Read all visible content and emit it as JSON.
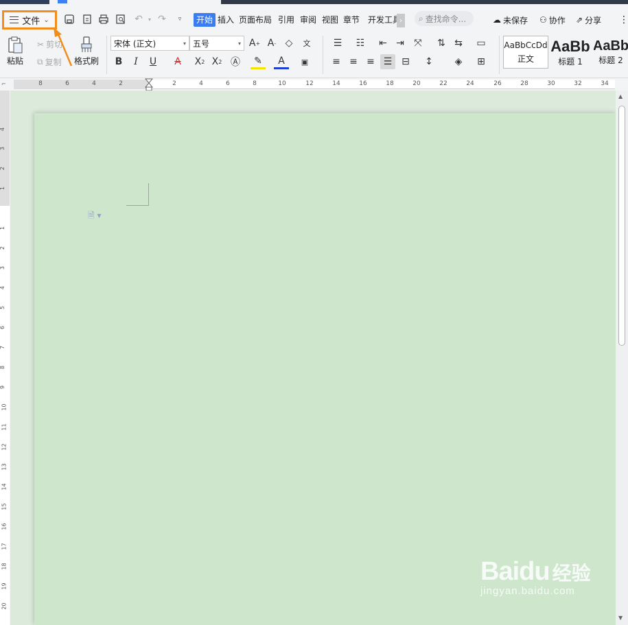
{
  "menubar": {
    "file_label": "文件",
    "tabs": [
      "开始",
      "插入",
      "页面布局",
      "引用",
      "审阅",
      "视图",
      "章节",
      "开发工具"
    ],
    "search_placeholder": "查找命令...",
    "unsaved": "未保存",
    "collaborate": "协作",
    "share": "分享"
  },
  "ribbon": {
    "paste": "粘贴",
    "cut": "剪切",
    "copy": "复制",
    "format_painter": "格式刷",
    "font_name": "宋体 (正文)",
    "font_size": "五号",
    "styles": [
      {
        "preview": "AaBbCcDd",
        "name": "正文"
      },
      {
        "preview": "AaBb",
        "name": "标题 1"
      },
      {
        "preview": "AaBb",
        "name": "标题 2"
      }
    ]
  },
  "hruler": {
    "ticks": [
      {
        "label": "8"
      },
      {
        "label": "6"
      },
      {
        "label": "4"
      },
      {
        "label": "2"
      },
      {
        "label": "2"
      },
      {
        "label": "4"
      },
      {
        "label": "6"
      },
      {
        "label": "8"
      },
      {
        "label": "10"
      },
      {
        "label": "12"
      },
      {
        "label": "14"
      },
      {
        "label": "16"
      },
      {
        "label": "18"
      },
      {
        "label": "20"
      },
      {
        "label": "22"
      },
      {
        "label": "24"
      },
      {
        "label": "26"
      },
      {
        "label": "28"
      },
      {
        "label": "30"
      },
      {
        "label": "32"
      },
      {
        "label": "34"
      }
    ]
  },
  "vruler": {
    "ticks": [
      "4",
      "3",
      "2",
      "1",
      "1",
      "2",
      "3",
      "4",
      "5",
      "6",
      "7",
      "8",
      "9",
      "10",
      "11",
      "12",
      "13",
      "14",
      "15",
      "16",
      "17",
      "18",
      "19",
      "20"
    ]
  },
  "watermark": {
    "logo": "Baidu",
    "cn": "经验",
    "url": "jingyan.baidu.com"
  },
  "colors": {
    "accent": "#3b7df0",
    "highlight": "#f28c1b",
    "page": "#cde6cc"
  }
}
